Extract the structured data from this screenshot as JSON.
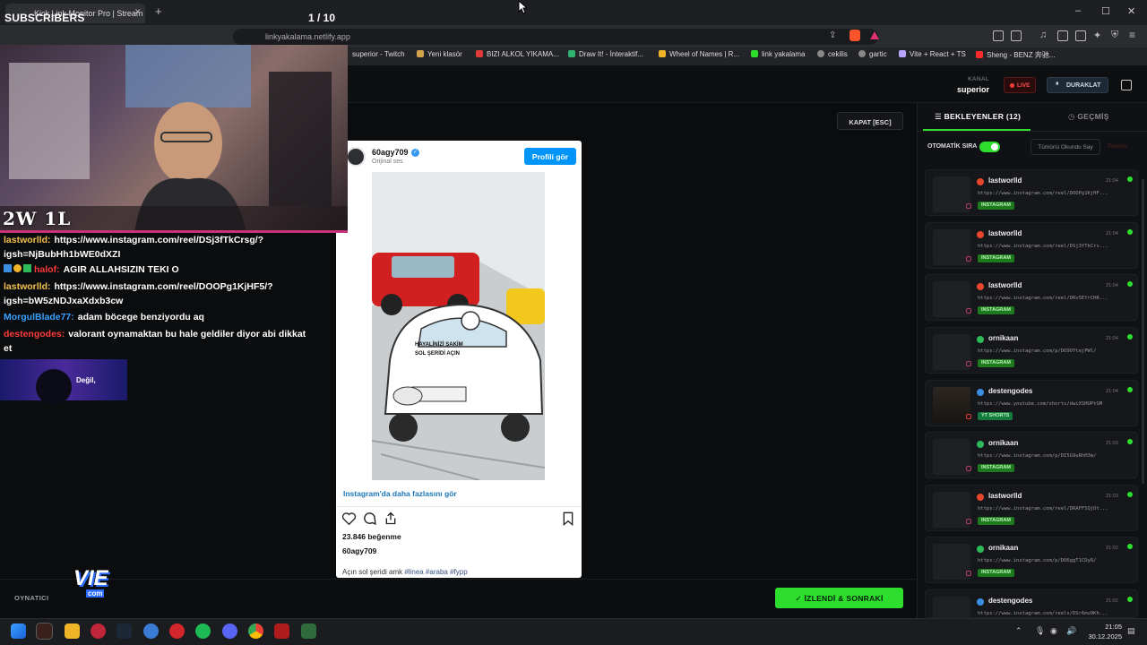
{
  "browser": {
    "tab_title": "Kick Link Monitor Pro | Stream",
    "url": "linkyakalama.netlify.app",
    "new_tab": "+",
    "bookmarks": [
      {
        "label": "superior - Twitch",
        "color": "#9146ff"
      },
      {
        "label": "Yeni klasör",
        "color": "#d0a24a"
      },
      {
        "label": "BIZI ALKOL YIKAMA...",
        "color": "#e03b3b"
      },
      {
        "label": "Draw It! - İnteraktif...",
        "color": "#2fb36e"
      },
      {
        "label": "Wheel of Names | R...",
        "color": "#f0b429"
      },
      {
        "label": "link yakalama",
        "color": "#2dde2d"
      },
      {
        "label": "cekilis",
        "color": "#888888"
      },
      {
        "label": "gartic",
        "color": "#888888"
      },
      {
        "label": "Vite + React + TS",
        "color": "#b7a5ff"
      },
      {
        "label": "Sheng - BENZ 奔驰...",
        "color": "#ff2b2b"
      }
    ]
  },
  "header": {
    "kanal_label": "KANAL",
    "kanal_value": "superior",
    "live_label": "LIVE",
    "pause_label": "DURAKLAT"
  },
  "viewer": {
    "close_label": "KAPAT [ESC]",
    "footer_label": "OYNATICI",
    "next_label": "İZLENDİ & SONRAKİ"
  },
  "post": {
    "username": "60agy709",
    "subtitle": "Orijinal ses",
    "profile_button": "Profili gör",
    "image_text_line1": "HAYALİNİZİ ŞAKİM",
    "image_text_line2": "SOL ŞERİDİ AÇIN",
    "more_link": "Instagram'da daha fazlasını gör",
    "likes": "23.846 beğenme",
    "caption_user": "60agy709",
    "caption_text": "Açın sol şeridi amk ",
    "hashtags": "#linea #araba #fypp"
  },
  "panel": {
    "tab_waiting": "BEKLEYENLER (12)",
    "tab_history": "GEÇMİŞ",
    "auto_queue_label": "OTOMATİK SIRA",
    "mark_all_label": "Tümünü Okundu Say",
    "clear_label": "Temizle",
    "queue": [
      {
        "user": "lastworlld",
        "time": "21:04",
        "url": "https://www.instagram.com/reel/DOOPg1KjHF...",
        "badge": "INSTAGRAM",
        "platform": "kick"
      },
      {
        "user": "lastworlld",
        "time": "21:04",
        "url": "https://www.instagram.com/reel/DSj3fTkCrs...",
        "badge": "INSTAGRAM",
        "platform": "kick"
      },
      {
        "user": "lastworlld",
        "time": "21:04",
        "url": "https://www.instagram.com/reel/DRx5EYrCHR...",
        "badge": "INSTAGRAM",
        "platform": "kick"
      },
      {
        "user": "ornikaan",
        "time": "21:04",
        "url": "https://www.instagram.com/p/DO9OYtejPWl/",
        "badge": "INSTAGRAM",
        "platform": "green"
      },
      {
        "user": "destengodes",
        "time": "21:04",
        "url": "https://www.youtube.com/shorts/dwiXSHUPtGM",
        "badge": "YT SHORTS",
        "platform": "blue"
      },
      {
        "user": "ornikaan",
        "time": "21:03",
        "url": "https://www.instagram.com/p/DI5G9uRhH3m/",
        "badge": "INSTAGRAM",
        "platform": "green"
      },
      {
        "user": "lastworlld",
        "time": "21:03",
        "url": "https://www.instagram.com/reel/DRAFF5QjDt...",
        "badge": "INSTAGRAM",
        "platform": "kick"
      },
      {
        "user": "ornikaan",
        "time": "21:02",
        "url": "https://www.instagram.com/p/DO6ggT1CDyR/",
        "badge": "INSTAGRAM",
        "platform": "green"
      },
      {
        "user": "destengodes",
        "time": "21:02",
        "url": "https://www.instagram.com/reels/DSr6mu9Kh...",
        "badge": "",
        "platform": "blue"
      }
    ]
  },
  "overlay": {
    "subscribers_label": "SUBSCRIBERS",
    "pager": "1  / 10",
    "score": "2W 1L",
    "alert_text": "Değil,",
    "chat": [
      {
        "user": "lastworlld:",
        "color": "#f2c14e",
        "text": "https://www.instagram.com/reel/DSj3fTkCrsg/?igsh=NjBubHh1bWE0dXZI"
      },
      {
        "user": "halof:",
        "color": "#ff3b3b",
        "text": "AGIR ALLAHSIZIN TEKI O"
      },
      {
        "user": "lastworlld:",
        "color": "#f2c14e",
        "text": "https://www.instagram.com/reel/DOOPg1KjHF5/?igsh=bW5zNDJxaXdxb3cw"
      },
      {
        "user": "MorgulBlade77:",
        "color": "#3aa0ff",
        "text": "adam böcege benziyordu aq"
      },
      {
        "user": "destengodes:",
        "color": "#ff3b3b",
        "text": "valorant oynamaktan bu hale geldiler diyor abi dikkat et"
      }
    ],
    "logo_text": "VIE",
    "logo_sub": "com"
  },
  "taskbar": {
    "time": "21:05",
    "date": "30.12.2025"
  }
}
